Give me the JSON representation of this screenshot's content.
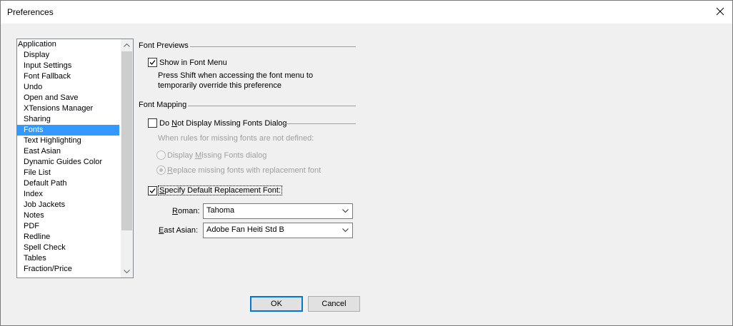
{
  "window": {
    "title": "Preferences"
  },
  "sidebar": {
    "items": [
      {
        "label": "Application"
      },
      {
        "label": "Display"
      },
      {
        "label": "Input Settings"
      },
      {
        "label": "Font Fallback"
      },
      {
        "label": "Undo"
      },
      {
        "label": "Open and Save"
      },
      {
        "label": "XTensions Manager"
      },
      {
        "label": "Sharing"
      },
      {
        "label": "Fonts"
      },
      {
        "label": "Text Highlighting"
      },
      {
        "label": "East Asian"
      },
      {
        "label": "Dynamic Guides Color"
      },
      {
        "label": "File List"
      },
      {
        "label": "Default Path"
      },
      {
        "label": "Index"
      },
      {
        "label": "Job Jackets"
      },
      {
        "label": "Notes"
      },
      {
        "label": "PDF"
      },
      {
        "label": "Redline"
      },
      {
        "label": "Spell Check"
      },
      {
        "label": "Tables"
      },
      {
        "label": "Fraction/Price"
      }
    ],
    "selected": "Fonts"
  },
  "font_previews": {
    "header": "Font Previews",
    "show_in_menu_label": "Show in Font Menu",
    "show_in_menu_checked": true,
    "hint_line1": "Press Shift when accessing the font menu to",
    "hint_line2": "temporarily override this preference"
  },
  "font_mapping": {
    "header": "Font Mapping",
    "do_not_display_pre": "Do ",
    "do_not_display_u": "N",
    "do_not_display_post": "ot Display Missing Fonts Dialog",
    "do_not_display_checked": false,
    "rules_hint": "When rules for missing fonts are not defined:",
    "radio_display_pre": "Display ",
    "radio_display_u": "M",
    "radio_display_post": "issing Fonts dialog",
    "radio_replace_pre": "",
    "radio_replace_u": "R",
    "radio_replace_post": "eplace missing fonts with replacement font",
    "specify_default_u": "S",
    "specify_default_post": "pecify Default Replacement Font:",
    "specify_default_checked": true,
    "roman_label_u": "R",
    "roman_label_post": "oman:",
    "roman_value": "Tahoma",
    "east_asian_label_u": "E",
    "east_asian_label_post": "ast Asian:",
    "east_asian_value": "Adobe Fan Heiti Std B"
  },
  "buttons": {
    "ok": "OK",
    "cancel": "Cancel"
  },
  "colors": {
    "selection": "#3399ff",
    "default_button_border": "#0078d7"
  }
}
